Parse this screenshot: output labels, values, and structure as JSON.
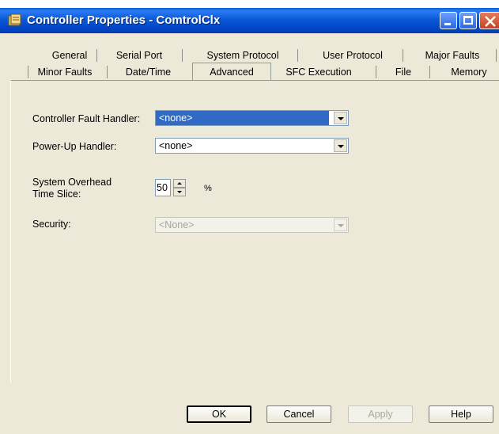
{
  "window": {
    "title": "Controller Properties - ComtrolClx"
  },
  "tabs": {
    "row1": [
      "General",
      "Serial Port",
      "System Protocol",
      "User Protocol",
      "Major Faults"
    ],
    "row2": [
      "Minor Faults",
      "Date/Time",
      "Advanced",
      "SFC Execution",
      "File",
      "Memory"
    ],
    "active": "Advanced"
  },
  "form": {
    "fault_handler_label": "Controller Fault Handler:",
    "fault_handler_value": "<none>",
    "powerup_label": "Power-Up Handler:",
    "powerup_value": "<none>",
    "overhead_label_line1": "System Overhead",
    "overhead_label_line2": "Time Slice:",
    "overhead_value": "50",
    "overhead_unit": "%",
    "security_label": "Security:",
    "security_value": "<None>"
  },
  "buttons": {
    "ok": "OK",
    "cancel": "Cancel",
    "apply": "Apply",
    "help": "Help"
  }
}
